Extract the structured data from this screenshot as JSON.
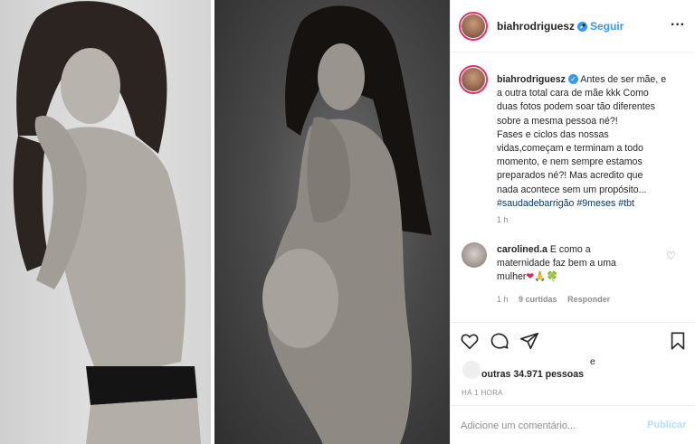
{
  "post": {
    "author": "biahrodriguesz",
    "follow_label": "Seguir",
    "dot_separator": "•",
    "more_icon": "more-options-icon",
    "verified_icon": "verified-badge-icon"
  },
  "caption": {
    "username": "biahrodriguesz",
    "lines": [
      "Antes de ser mãe, e",
      "a outra total cara de mãe kkk Como",
      "duas fotos podem soar tão diferentes",
      "sobre a mesma pessoa né?!",
      "Fases e ciclos das nossas",
      "vidas,começam e terminam a todo",
      "momento, e nem sempre estamos",
      "preparados né?! Mas acredito que",
      "nada acontece sem um propósito..."
    ],
    "hashtags": "#saudadebarrigão #9meses #tbt",
    "time": "1 h"
  },
  "comment": {
    "username": "carolined.a",
    "text_line1": "E como a",
    "text_line2": "maternidade faz bem a uma",
    "text_line3": "mulher",
    "emoji_heart": "❤",
    "emoji_pray": "🙏",
    "emoji_clover": "🍀",
    "time": "1 h",
    "likes": "9 curtidas",
    "reply_label": "Responder"
  },
  "likes": {
    "and_text": "e",
    "others": "outras 34.971 pessoas"
  },
  "post_age": "HÁ 1 HORA",
  "comment_input": {
    "placeholder": "Adicione um comentário...",
    "publish_label": "Publicar"
  }
}
